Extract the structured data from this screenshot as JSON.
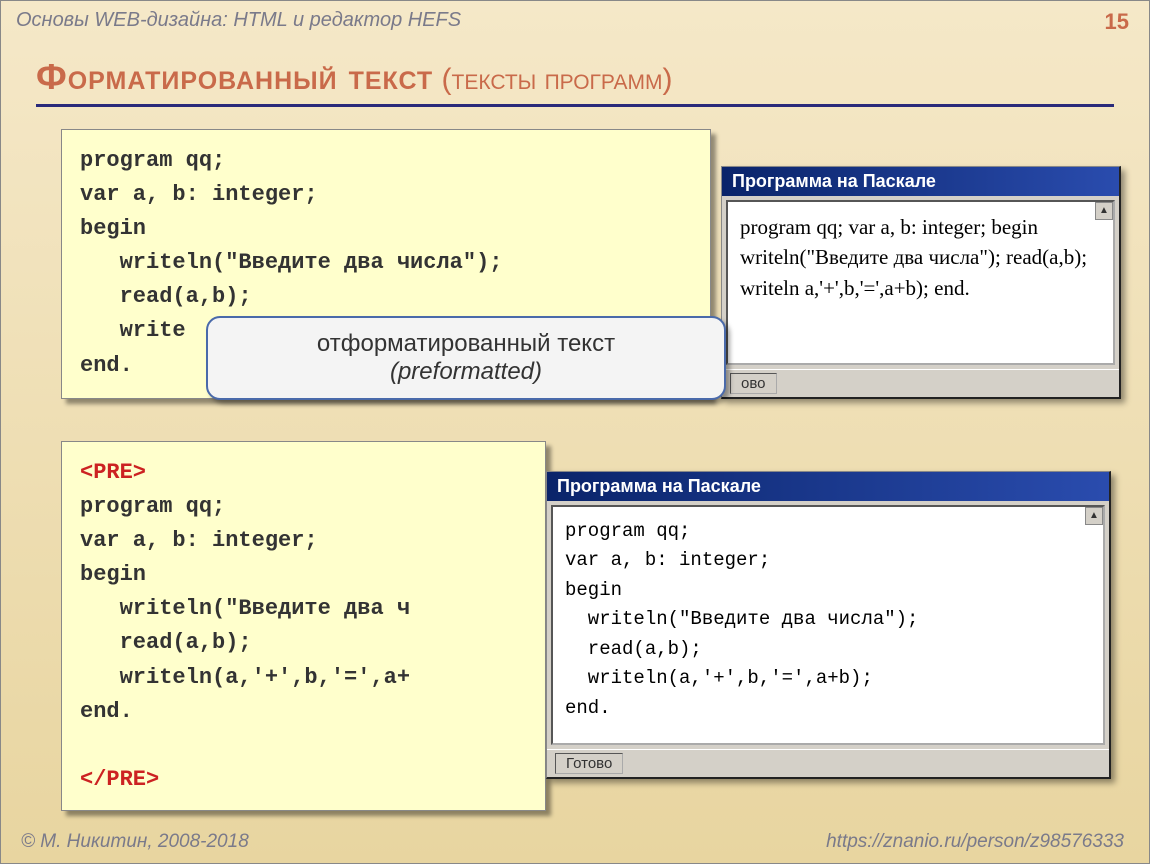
{
  "header": "Основы WEB-дизайна: HTML и редактор HEFS",
  "page_number": "15",
  "title_main": "Форматированный текст",
  "title_sub": " (тексты программ)",
  "code_top": "program qq;\nvar a, b: integer;\nbegin\n   writeln(\"Введите два числа\");\n   read(a,b);\n   write\nend.",
  "callout_line1": "отформатированный текст",
  "callout_line2": "(preformatted)",
  "code_bottom_open": "<PRE>",
  "code_bottom_body": "program qq;\nvar a, b: integer;\nbegin\n   writeln(\"Введите два ч\n   read(a,b);\n   writeln(a,'+',b,'=',a+\nend.\n",
  "code_bottom_close": "</PRE>",
  "browser1": {
    "title": "Программа на Паскале",
    "body": "program qq; var a, b: integer; begin writeln(\"Введите два числа\"); read(a,b); writeln       a,'+',b,'=',a+b); end.",
    "status": "ово"
  },
  "browser2": {
    "title": "Программа на Паскале",
    "body": "program qq;\nvar a, b: integer;\nbegin\n  writeln(\"Введите два числа\");\n  read(a,b);\n  writeln(a,'+',b,'=',a+b);\nend.",
    "status": "Готово"
  },
  "footer_left": "© М. Никитин, 2008-2018",
  "footer_right": "https://znanio.ru/person/z98576333"
}
